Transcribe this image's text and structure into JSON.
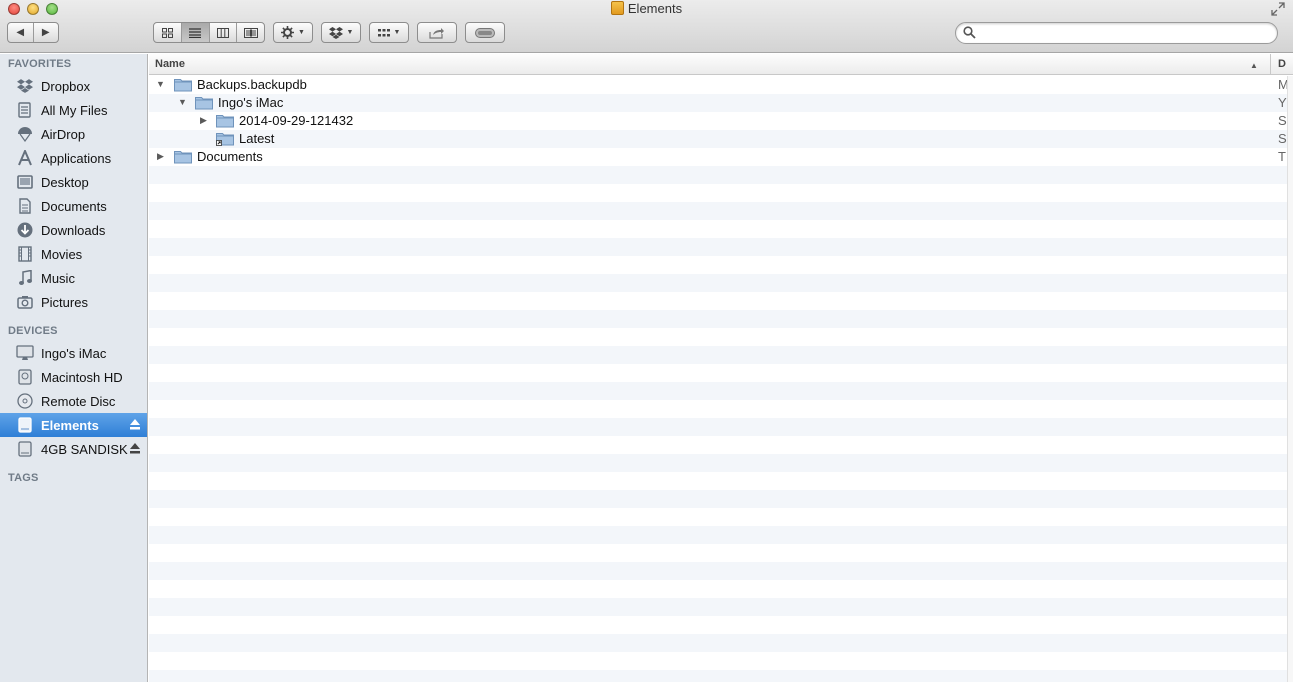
{
  "window": {
    "title": "Elements"
  },
  "toolbar": {
    "back_label": "◀",
    "forward_label": "▶",
    "view_modes": [
      "icon-view",
      "list-view",
      "column-view",
      "cover-flow-view"
    ],
    "active_view": "list-view",
    "search": {
      "value": "",
      "placeholder": ""
    }
  },
  "sidebar": {
    "favorites_header": "FAVORITES",
    "favorites": [
      {
        "label": "Dropbox",
        "icon": "dropbox-icon"
      },
      {
        "label": "All My Files",
        "icon": "all-files-icon"
      },
      {
        "label": "AirDrop",
        "icon": "airdrop-icon"
      },
      {
        "label": "Applications",
        "icon": "applications-icon"
      },
      {
        "label": "Desktop",
        "icon": "desktop-icon"
      },
      {
        "label": "Documents",
        "icon": "documents-icon"
      },
      {
        "label": "Downloads",
        "icon": "downloads-icon"
      },
      {
        "label": "Movies",
        "icon": "movies-icon"
      },
      {
        "label": "Music",
        "icon": "music-icon"
      },
      {
        "label": "Pictures",
        "icon": "pictures-icon"
      }
    ],
    "devices_header": "DEVICES",
    "devices": [
      {
        "label": "Ingo's iMac",
        "icon": "imac-icon"
      },
      {
        "label": "Macintosh HD",
        "icon": "hard-drive-icon"
      },
      {
        "label": "Remote Disc",
        "icon": "remote-disc-icon"
      },
      {
        "label": "Elements",
        "icon": "external-drive-icon",
        "selected": true,
        "ejectable": true
      },
      {
        "label": "4GB SANDISK",
        "icon": "external-drive-icon",
        "ejectable": true
      }
    ],
    "tags_header": "TAGS"
  },
  "list": {
    "columns": {
      "name": "Name",
      "date": "D"
    },
    "sort_indicator": "▲",
    "rows": [
      {
        "label": "Backups.backupdb",
        "level": 0,
        "disclosure": "expanded",
        "date": "M"
      },
      {
        "label": "Ingo's iMac",
        "level": 1,
        "disclosure": "expanded",
        "date": "Y"
      },
      {
        "label": "2014-09-29-121432",
        "level": 2,
        "disclosure": "collapsed",
        "date": "S"
      },
      {
        "label": "Latest",
        "level": 2,
        "disclosure": "none",
        "alias": true,
        "date": "S"
      },
      {
        "label": "Documents",
        "level": 0,
        "disclosure": "collapsed",
        "date": "T"
      }
    ]
  },
  "colors": {
    "selection": "#3a86db",
    "sidebar_bg": "#e3e8ee",
    "stripe": "#f3f6fa"
  }
}
